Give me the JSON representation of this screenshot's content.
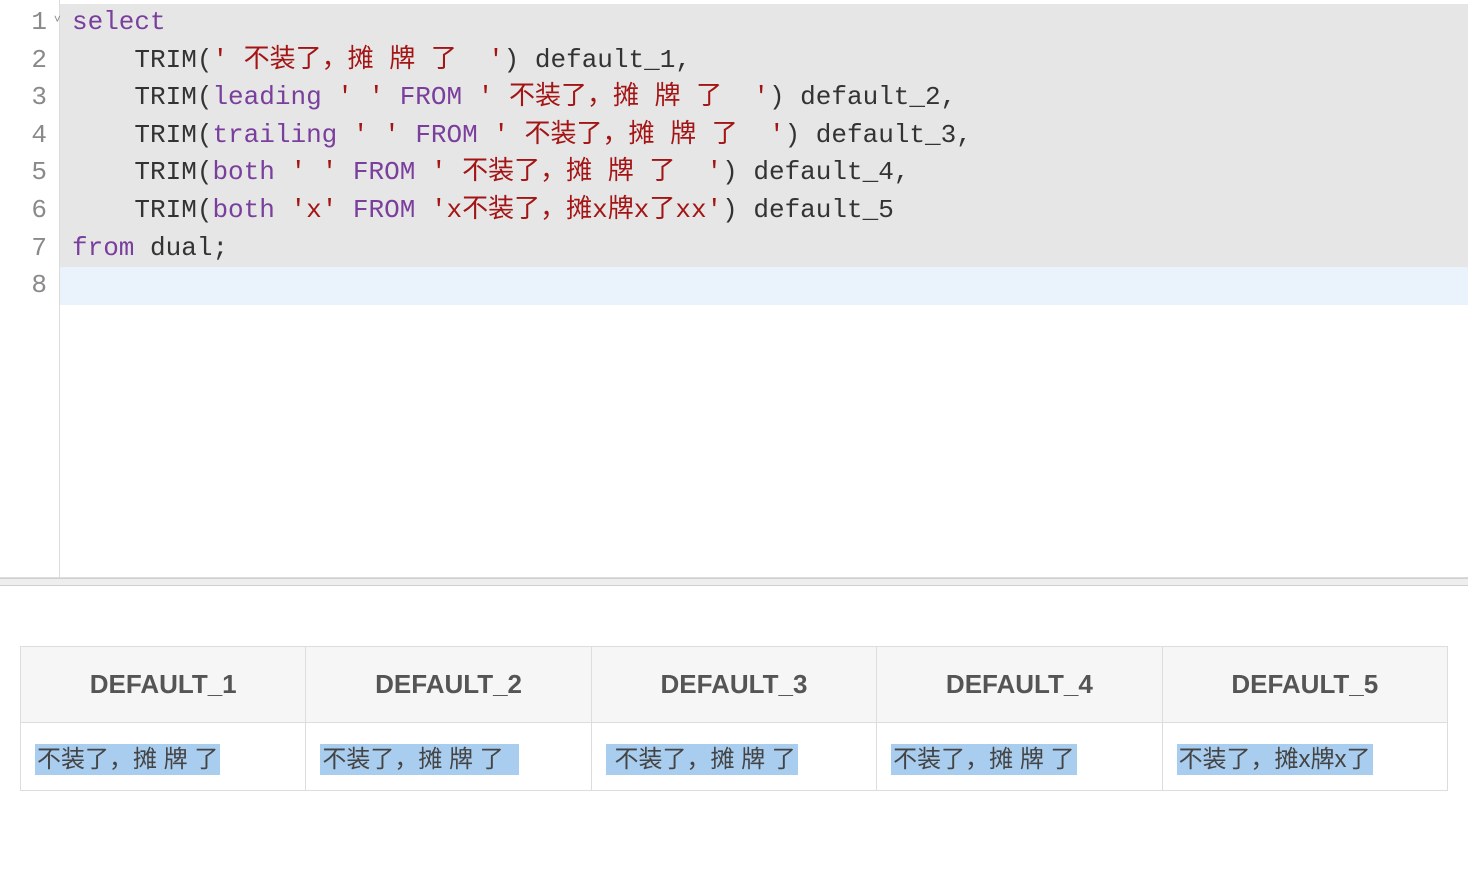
{
  "editor": {
    "gutter": [
      "1",
      "2",
      "3",
      "4",
      "5",
      "6",
      "7",
      "8"
    ],
    "fold_marker_on_line": 1,
    "lines": [
      [
        {
          "cls": "kw",
          "t": "select"
        }
      ],
      [
        {
          "cls": "punc",
          "t": "    "
        },
        {
          "cls": "fn",
          "t": "TRIM"
        },
        {
          "cls": "punc",
          "t": "("
        },
        {
          "cls": "str",
          "t": "' 不装了，摊 牌 了  '"
        },
        {
          "cls": "punc",
          "t": ") "
        },
        {
          "cls": "id",
          "t": "default_1"
        },
        {
          "cls": "punc",
          "t": ","
        }
      ],
      [
        {
          "cls": "punc",
          "t": "    "
        },
        {
          "cls": "fn",
          "t": "TRIM"
        },
        {
          "cls": "punc",
          "t": "("
        },
        {
          "cls": "kw",
          "t": "leading"
        },
        {
          "cls": "punc",
          "t": " "
        },
        {
          "cls": "str",
          "t": "' '"
        },
        {
          "cls": "punc",
          "t": " "
        },
        {
          "cls": "kw",
          "t": "FROM"
        },
        {
          "cls": "punc",
          "t": " "
        },
        {
          "cls": "str",
          "t": "' 不装了，摊 牌 了  '"
        },
        {
          "cls": "punc",
          "t": ") "
        },
        {
          "cls": "id",
          "t": "default_2"
        },
        {
          "cls": "punc",
          "t": ","
        }
      ],
      [
        {
          "cls": "punc",
          "t": "    "
        },
        {
          "cls": "fn",
          "t": "TRIM"
        },
        {
          "cls": "punc",
          "t": "("
        },
        {
          "cls": "kw",
          "t": "trailing"
        },
        {
          "cls": "punc",
          "t": " "
        },
        {
          "cls": "str",
          "t": "' '"
        },
        {
          "cls": "punc",
          "t": " "
        },
        {
          "cls": "kw",
          "t": "FROM"
        },
        {
          "cls": "punc",
          "t": " "
        },
        {
          "cls": "str",
          "t": "' 不装了，摊 牌 了  '"
        },
        {
          "cls": "punc",
          "t": ") "
        },
        {
          "cls": "id",
          "t": "default_3"
        },
        {
          "cls": "punc",
          "t": ","
        }
      ],
      [
        {
          "cls": "punc",
          "t": "    "
        },
        {
          "cls": "fn",
          "t": "TRIM"
        },
        {
          "cls": "punc",
          "t": "("
        },
        {
          "cls": "kw",
          "t": "both"
        },
        {
          "cls": "punc",
          "t": " "
        },
        {
          "cls": "str",
          "t": "' '"
        },
        {
          "cls": "punc",
          "t": " "
        },
        {
          "cls": "kw",
          "t": "FROM"
        },
        {
          "cls": "punc",
          "t": " "
        },
        {
          "cls": "str",
          "t": "' 不装了，摊 牌 了  '"
        },
        {
          "cls": "punc",
          "t": ") "
        },
        {
          "cls": "id",
          "t": "default_4"
        },
        {
          "cls": "punc",
          "t": ","
        }
      ],
      [
        {
          "cls": "punc",
          "t": "    "
        },
        {
          "cls": "fn",
          "t": "TRIM"
        },
        {
          "cls": "punc",
          "t": "("
        },
        {
          "cls": "kw",
          "t": "both"
        },
        {
          "cls": "punc",
          "t": " "
        },
        {
          "cls": "str",
          "t": "'x'"
        },
        {
          "cls": "punc",
          "t": " "
        },
        {
          "cls": "kw",
          "t": "FROM"
        },
        {
          "cls": "punc",
          "t": " "
        },
        {
          "cls": "str",
          "t": "'x不装了，摊x牌x了xx'"
        },
        {
          "cls": "punc",
          "t": ") "
        },
        {
          "cls": "id",
          "t": "default_5"
        }
      ],
      [
        {
          "cls": "kw",
          "t": "from"
        },
        {
          "cls": "punc",
          "t": " "
        },
        {
          "cls": "id",
          "t": "dual"
        },
        {
          "cls": "punc",
          "t": ";"
        }
      ],
      []
    ],
    "active_line_index": 7
  },
  "results": {
    "columns": [
      "DEFAULT_1",
      "DEFAULT_2",
      "DEFAULT_3",
      "DEFAULT_4",
      "DEFAULT_5"
    ],
    "rows": [
      [
        "不装了，摊 牌 了",
        "不装了，摊 牌 了  ",
        " 不装了，摊 牌 了",
        "不装了，摊 牌 了",
        "不装了，摊x牌x了"
      ]
    ]
  }
}
